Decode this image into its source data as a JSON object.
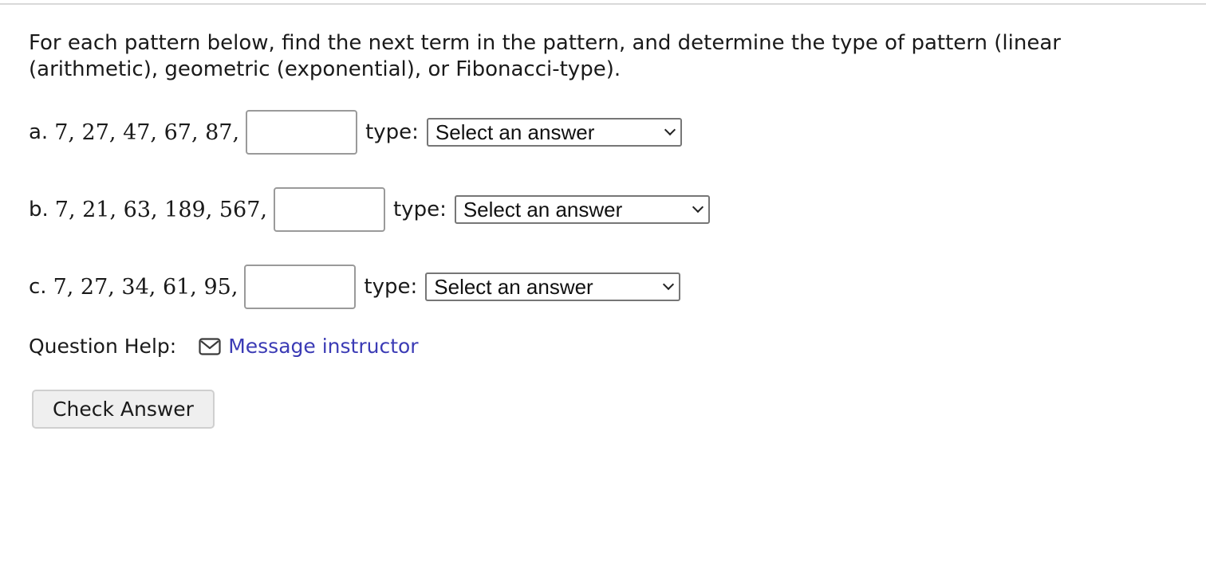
{
  "question": {
    "prompt": "For each pattern below, find the next term in the pattern, and determine the type of pattern (linear (arithmetic), geometric (exponential), or Fibonacci-type)."
  },
  "patterns": [
    {
      "label": "a.",
      "sequence": "7, 27, 47, 67, 87,",
      "answer_value": "",
      "type_label": "type:",
      "select_value": "Select an answer"
    },
    {
      "label": "b.",
      "sequence": "7, 21, 63, 189, 567,",
      "answer_value": "",
      "type_label": "type:",
      "select_value": "Select an answer"
    },
    {
      "label": "c.",
      "sequence": "7, 27, 34, 61, 95,",
      "answer_value": "",
      "type_label": "type:",
      "select_value": "Select an answer"
    }
  ],
  "help": {
    "label": "Question Help:",
    "icon": "mail-icon",
    "link_text": "Message instructor"
  },
  "actions": {
    "check_answer": "Check Answer"
  },
  "colors": {
    "link": "#3b3bb5",
    "button_bg": "#efefef",
    "input_border": "#9a9a9a"
  }
}
